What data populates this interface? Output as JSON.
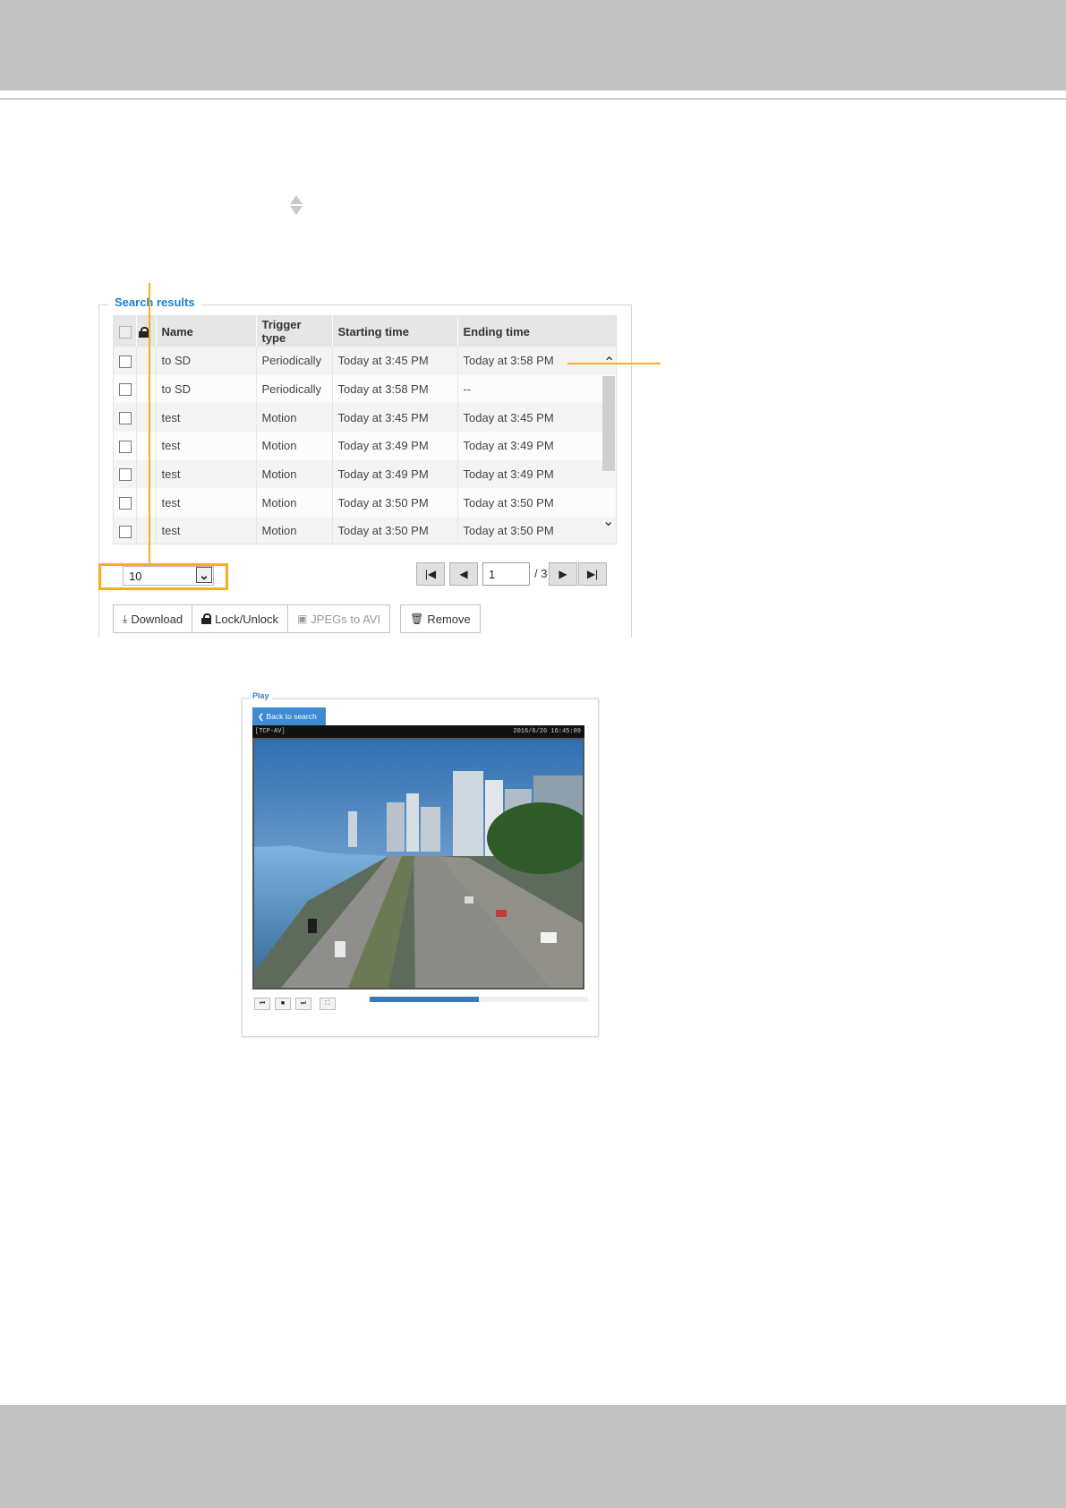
{
  "search_results": {
    "legend": "Search results",
    "columns": [
      "Name",
      "Trigger type",
      "Starting time",
      "Ending time"
    ],
    "rows": [
      {
        "name": "to SD",
        "trigger": "Periodically",
        "start": "Today at 3:45 PM",
        "end": "Today at 3:58 PM"
      },
      {
        "name": "to SD",
        "trigger": "Periodically",
        "start": "Today at 3:58 PM",
        "end": "--"
      },
      {
        "name": "test",
        "trigger": "Motion",
        "start": "Today at 3:45 PM",
        "end": "Today at 3:45 PM"
      },
      {
        "name": "test",
        "trigger": "Motion",
        "start": "Today at 3:49 PM",
        "end": "Today at 3:49 PM"
      },
      {
        "name": "test",
        "trigger": "Motion",
        "start": "Today at 3:49 PM",
        "end": "Today at 3:49 PM"
      },
      {
        "name": "test",
        "trigger": "Motion",
        "start": "Today at 3:50 PM",
        "end": "Today at 3:50 PM"
      },
      {
        "name": "test",
        "trigger": "Motion",
        "start": "Today at 3:50 PM",
        "end": "Today at 3:50 PM"
      }
    ],
    "per_page": "10",
    "pagination": {
      "current": "1",
      "total": "/ 3"
    },
    "actions": {
      "download": "Download",
      "lock": "Lock/Unlock",
      "jpegs": "JPEGs to AVI",
      "remove": "Remove"
    }
  },
  "play": {
    "legend": "Play",
    "back_label": "Back to search",
    "osd_left": "[TCP-AV]",
    "osd_right": "2016/6/26 16:45:09",
    "progress": 0.5,
    "controls": [
      "previous-icon",
      "stop-icon",
      "next-icon",
      "fullscreen-icon"
    ]
  },
  "colors": {
    "accent": "#1f7fd2",
    "callout": "#f2b01e",
    "band": "#c1c1c1"
  }
}
